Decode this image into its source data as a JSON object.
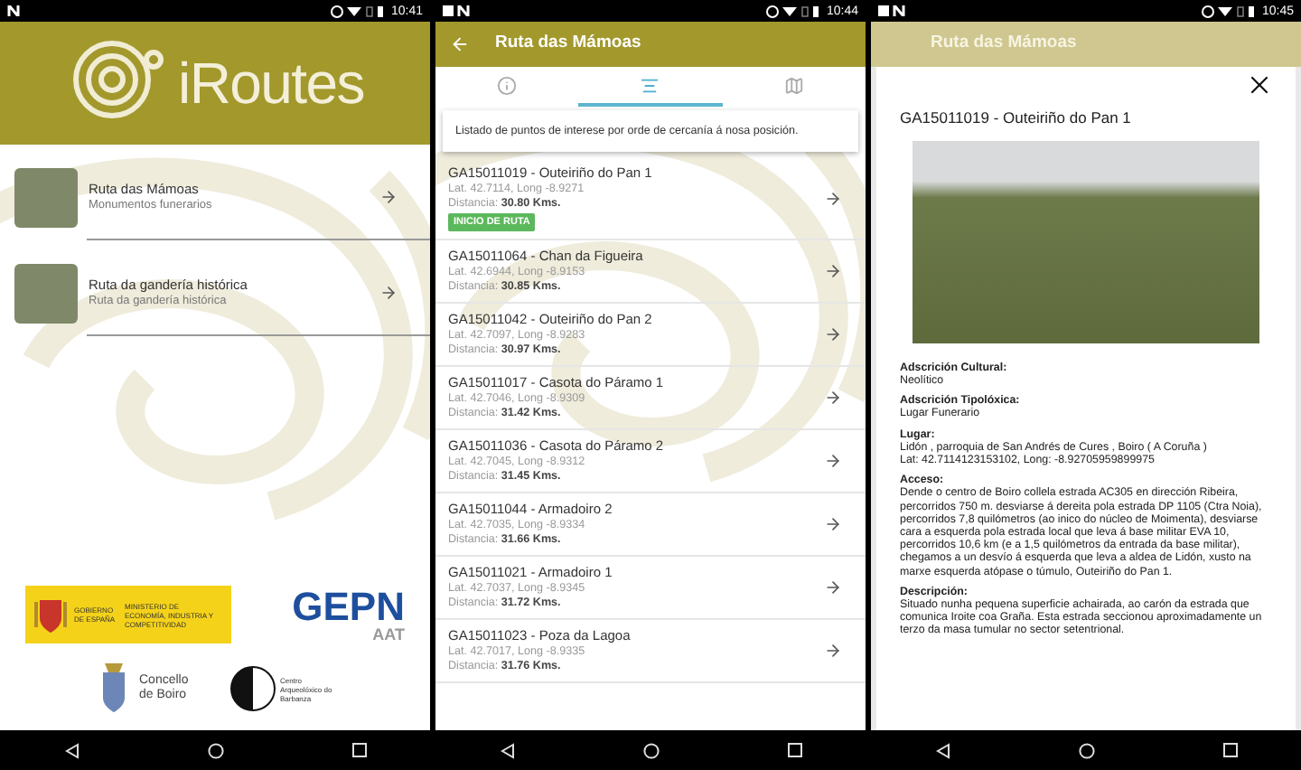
{
  "home": {
    "status_bar": {
      "time": "10:41"
    },
    "app_name": "iRoutes",
    "routes": [
      {
        "title": "Ruta das Mámoas",
        "subtitle": "Monumentos funerarios"
      },
      {
        "title": "Ruta da gandería histórica",
        "subtitle": "Ruta da gandería histórica"
      }
    ],
    "sponsors": {
      "ministry": [
        "GOBIERNO DE ESPAÑA",
        "MINISTERIO DE ECONOMÍA, INDUSTRIA Y COMPETITIVIDAD"
      ],
      "gepn": {
        "name": "GEPN",
        "sub": "AAT"
      },
      "council": "Concello de Boiro",
      "centre": "Centro Arqueolóxico do Barbanza"
    }
  },
  "list": {
    "status_bar": {
      "time": "10:44"
    },
    "title": "Ruta das Mámoas",
    "tabs": [
      {
        "kind": "info",
        "selected": false
      },
      {
        "kind": "list",
        "selected": true
      },
      {
        "kind": "map",
        "selected": false
      }
    ],
    "intro": "Listado de puntos de interese por orde de cercanía á nosa posición.",
    "points": [
      {
        "title": "GA15011019 - Outeiriño do Pan 1",
        "coords": "Lat. 42.7114, Long -8.9271",
        "distance": "Distancia: **30.80 Kms.**",
        "badge": "INICIO DE RUTA"
      },
      {
        "title": "GA15011064 - Chan da Figueira",
        "coords": "Lat. 42.6944, Long -8.9153",
        "distance": "Distancia: **30.85 Kms.**"
      },
      {
        "title": "GA15011042 - Outeiriño do Pan 2",
        "coords": "Lat. 42.7097, Long -8.9283",
        "distance": "Distancia: **30.97 Kms.**"
      },
      {
        "title": "GA15011017 - Casota do Páramo 1",
        "coords": "Lat. 42.7046, Long -8.9309",
        "distance": "Distancia: **31.42 Kms.**"
      },
      {
        "title": "GA15011036 - Casota do Páramo 2",
        "coords": "Lat. 42.7045, Long -8.9312",
        "distance": "Distancia: **31.45 Kms.**"
      },
      {
        "title": "GA15011044 - Armadoiro 2",
        "coords": "Lat. 42.7035, Long -8.9334",
        "distance": "Distancia: **31.66 Kms.**"
      },
      {
        "title": "GA15011021 - Armadoiro 1",
        "coords": "Lat. 42.7037, Long -8.9345",
        "distance": "Distancia: **31.72 Kms.**"
      },
      {
        "title": "GA15011023 - Poza da Lagoa",
        "coords": "Lat. 42.7017, Long -8.9335",
        "distance": "Distancia: **31.76 Kms.**"
      }
    ]
  },
  "detail": {
    "status_bar": {
      "time": "10:45"
    },
    "background_title": "Ruta das Mámoas",
    "title": "GA15011019 - Outeiriño do Pan 1",
    "fields": [
      {
        "label": "Adscrición Cultural:",
        "lines": [
          "Neolítico"
        ]
      },
      {
        "label": "Adscrición Tipolóxica:",
        "lines": [
          "Lugar Funerario"
        ]
      },
      {
        "label": "Lugar:",
        "lines": [
          "Lidón , parroquia de San Andrés de Cures , Boiro ( A Coruña )",
          "Lat: 42.7114123153102, Long: -8.92705959899975"
        ]
      },
      {
        "label": "Acceso:",
        "lines": [
          "Dende o centro de Boiro collela estrada AC305 en dirección Ribeira, percorridos 750 m. desviarse á dereita pola estrada DP 1105 (Ctra Noia), percorridos 7,8 quilómetros (ao inico do núcleo de Moimenta), desviarse cara a esquerda pola estrada local que leva á base militar EVA 10, percorridos 10,6 km (e a 1,5 quilómetros da entrada da base militar), chegamos a un desvío á esquerda que leva a aldea de Lidón, xusto na marxe esquerda atópase o túmulo, Outeiriño do Pan 1."
        ]
      },
      {
        "label": "Descripción:",
        "lines": [
          "Situado nunha pequena superficie achairada, ao carón da estrada que comunica Iroite coa Graña. Esta estrada seccionou aproximadamente un terzo da masa tumular no sector setentrional."
        ]
      }
    ]
  }
}
